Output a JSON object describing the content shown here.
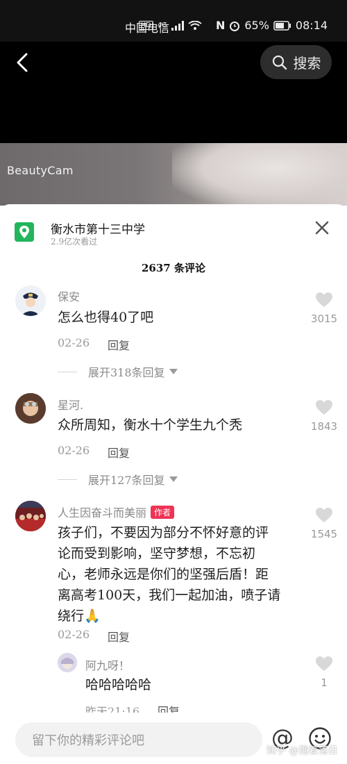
{
  "status_bar": {
    "carrier": "中国电信",
    "network": "4G",
    "battery": "65%",
    "time": "08:14"
  },
  "video": {
    "watermark": "BeautyCam"
  },
  "header": {
    "search_label": "搜索"
  },
  "location": {
    "title": "衡水市第十三中学",
    "views": "2.9亿次看过"
  },
  "comments_count": "2637 条评论",
  "comments": [
    {
      "name": "保安",
      "text": "怎么也得40了吧",
      "date": "02-26",
      "reply": "回复",
      "expand": "展开318条回复",
      "likes": "3015"
    },
    {
      "name": "星河.",
      "text": "众所周知，衡水十个学生九个秃",
      "date": "02-26",
      "reply": "回复",
      "expand": "展开127条回复",
      "likes": "1843"
    },
    {
      "name": "人生因奋斗而美丽",
      "tag": "作者",
      "lines": [
        "孩子们，不要因为部分不怀好意的评",
        "论而受到影响，坚守梦想，不忘初",
        "心，老师永远是你们的坚强后盾！距",
        "离高考100天，我们一起加油，喷子请",
        "绕行🙏"
      ],
      "date": "02-26",
      "reply": "回复",
      "likes": "1545"
    }
  ],
  "sub_reply": {
    "name": "阿九呀！",
    "text": "哈哈哈哈哈",
    "date": "昨天21:16",
    "reply": "回复",
    "likes": "1"
  },
  "input": {
    "placeholder": "留下你的精彩评论吧"
  },
  "site_watermark": "知乎 @抱着落日",
  "colors": {
    "location_icon": "#22b55c",
    "author_tag": "#ee3355"
  }
}
